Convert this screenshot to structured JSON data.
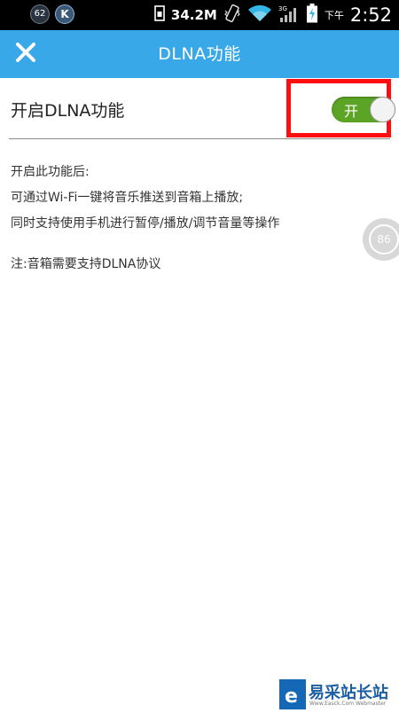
{
  "status_bar": {
    "notif_badge_1": "62",
    "notif_badge_2": "K",
    "data_usage": "34.2M",
    "network_label": "3G",
    "ampm": "下午",
    "clock": "2:52"
  },
  "header": {
    "title": "DLNA功能",
    "close_icon": "close-icon",
    "bg_color": "#38a8e8"
  },
  "setting": {
    "label": "开启DLNA功能",
    "toggle_label": "开",
    "toggle_state": "on",
    "toggle_color": "#5ba426",
    "highlight_color": "#ff0d10"
  },
  "description": {
    "line1": "开启此功能后:",
    "line2": "可通过Wi-Fi一键将音乐推送到音箱上播放;",
    "line3": "同时支持使用手机进行暂停/播放/调节音量等操作",
    "note": "注:音箱需要支持DLNA协议"
  },
  "floating_badge": {
    "value": "86"
  },
  "watermark": {
    "text": "易采站长站",
    "sub": "Www.Easck.Com Webmaster"
  }
}
